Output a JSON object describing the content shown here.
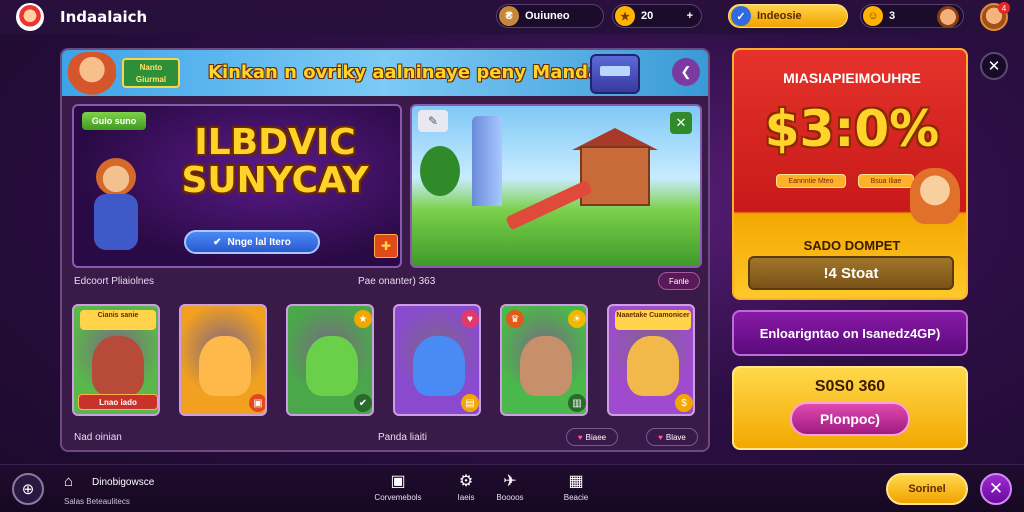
{
  "topbar": {
    "app_title": "Indaalaich",
    "logo_icon": "mascot-logo-icon",
    "coins": {
      "icon": "wallet-icon",
      "value": "Ouiuneo"
    },
    "gems": {
      "icon": "gem-icon",
      "value": "20",
      "plus": "+"
    },
    "offer": {
      "icon": "shield-icon",
      "label": "Indeosie"
    },
    "lives": {
      "icon": "smiley-icon",
      "value": "3"
    },
    "profile_badge": "4"
  },
  "banner": {
    "badge_text": "Nanto Giurmal",
    "text": "Kinkan n ovriky aalninaye peny Mandac!",
    "share_icon": "share-icon"
  },
  "promo": {
    "tag": "Guio suno",
    "title_line1": "ILBDVIC",
    "title_line2": "SUNYCAY",
    "button_label": "Nnge lal Itero",
    "button_icon": "check-icon",
    "gift_icon": "gift-icon"
  },
  "scene": {
    "close_icon": "close-icon",
    "pencil_icon": "pencil-icon"
  },
  "section": {
    "left_label": "Edcoort Pliaiolnes",
    "center_label": "Pae onanter) 363",
    "button_label": "Fanle"
  },
  "tiles": [
    {
      "name": "boar",
      "title": "Cianis sanie",
      "tag": "Lnao iado",
      "bg": "#5ab84a",
      "char": "#b84a3a"
    },
    {
      "name": "fox",
      "title": "",
      "tag": "",
      "bg": "#f2a020",
      "char": "#ffb84a"
    },
    {
      "name": "dragon",
      "title": "",
      "tag": "",
      "bg": "#4aa84a",
      "char": "#6ad04a"
    },
    {
      "name": "cat",
      "title": "",
      "tag": "",
      "bg": "#8a4ad0",
      "char": "#4a8af5"
    },
    {
      "name": "donkey",
      "title": "",
      "tag": "",
      "bg": "#4ab84a",
      "char": "#c8906a"
    },
    {
      "name": "hamster",
      "title": "Naaetake Cuamonicer",
      "tag": "",
      "bg": "#a04ad0",
      "char": "#f2b84a"
    }
  ],
  "footer": {
    "left_label": "Nad oinian",
    "center_label": "Panda liaiti",
    "btn1": "Biaee",
    "btn2": "Blave"
  },
  "sale": {
    "title": "MIASIAPIEIMOUHRE",
    "percent": "$3:0%",
    "chip1": "Eannntie Mteo",
    "chip2": "Bsua Iliae",
    "subtitle": "SADO DOMPET",
    "button_label": "!4 Stoat"
  },
  "promo_banner": "Enloarigntao on Isanedz4GP)",
  "pack": {
    "title": "S0S0 360",
    "button_label": "Plonpoc)"
  },
  "bottombar": {
    "globe_icon": "globe-icon",
    "home_title": "Dinobigowsce",
    "home_sub": "Salas Beteaulitecs",
    "items": [
      {
        "icon": "shop-icon",
        "label": "Corvemebols"
      },
      {
        "icon": "settings-icon",
        "label": "Iaeis"
      },
      {
        "icon": "plane-icon",
        "label": "Boooos"
      },
      {
        "icon": "grid-icon",
        "label": "Beacie"
      }
    ],
    "start_label": "Sorinel",
    "close_icon": "close-icon"
  }
}
